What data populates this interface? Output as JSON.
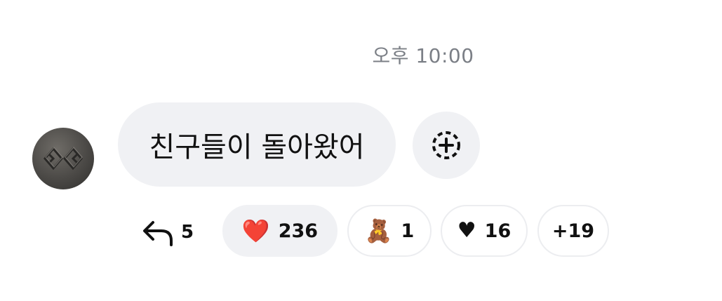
{
  "timestamp": "오후 10:00",
  "message": {
    "text": "친구들이 돌아왔어"
  },
  "add_reaction": {
    "icon": "dashed-circle-plus-icon"
  },
  "reply": {
    "icon": "reply-arrow-icon",
    "count": "5"
  },
  "reactions": [
    {
      "emoji": "❤️",
      "count": "236",
      "selected": true,
      "icon": "red-heart-emoji"
    },
    {
      "emoji": "🧸",
      "count": "1",
      "selected": false,
      "icon": "teddy-bear-emoji"
    },
    {
      "emoji": "♥",
      "count": "16",
      "selected": false,
      "icon": "black-heart-icon"
    }
  ],
  "more_reactions": "+19",
  "colors": {
    "bubble": "#f0f1f4",
    "timestamp": "#7b7f86",
    "text": "#111111",
    "heart": "#e0192c"
  }
}
